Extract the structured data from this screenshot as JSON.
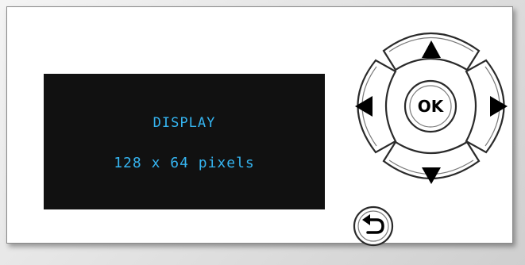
{
  "display": {
    "title": "DISPLAY",
    "resolution": "128 x 64 pixels"
  },
  "keypad": {
    "ok_label": "OK",
    "up_icon": "triangle-up",
    "down_icon": "triangle-down",
    "left_icon": "triangle-left",
    "right_icon": "triangle-right",
    "back_icon": "return-arrow"
  },
  "colors": {
    "screen_bg": "#111111",
    "screen_text": "#35b4f0"
  }
}
